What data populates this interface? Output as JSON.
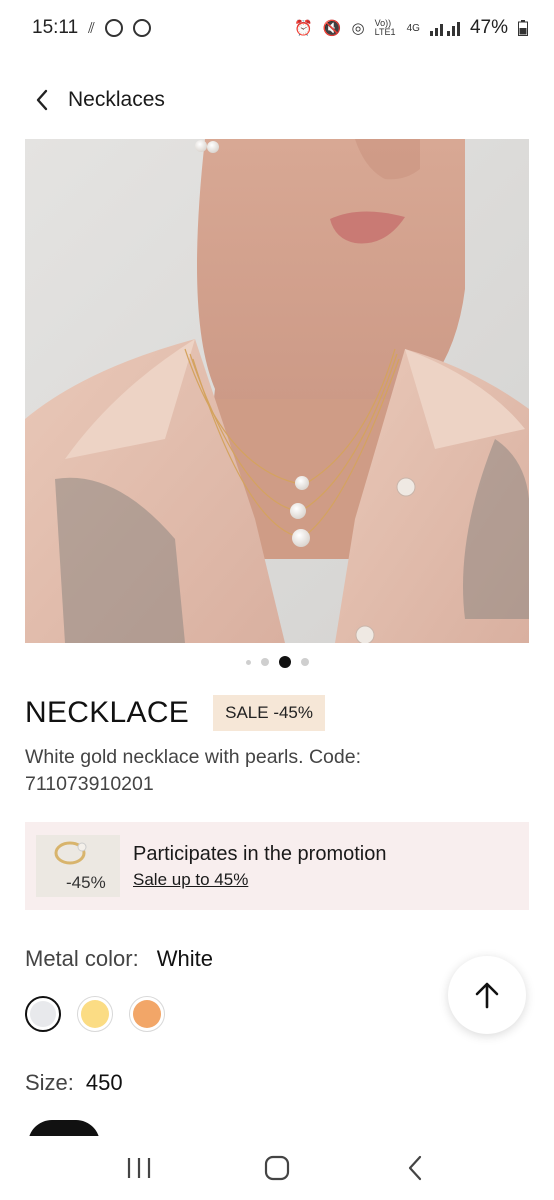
{
  "status_bar": {
    "time": "15:11",
    "battery": "47%",
    "network_volte": "Vo)) LTE1",
    "network_4g": "4G"
  },
  "header": {
    "title": "Necklaces",
    "back_icon": "chevron-left-icon"
  },
  "gallery": {
    "image_count": 4,
    "active_index": 2
  },
  "product": {
    "name": "NECKLACE",
    "sale_badge": "SALE -45%",
    "description": "White gold necklace with pearls. Code: 711073910201"
  },
  "promotion": {
    "thumb_text": "-45%",
    "title": "Participates in the promotion",
    "link": "Sale up to 45%"
  },
  "metal": {
    "label": "Metal color:",
    "value": "White",
    "swatches": [
      {
        "name": "white",
        "color": "#e8e9ec",
        "selected": true
      },
      {
        "name": "yellow",
        "color": "#fbdc84",
        "selected": false
      },
      {
        "name": "rose",
        "color": "#f2a668",
        "selected": false
      }
    ]
  },
  "size": {
    "label": "Size:",
    "value": "450"
  },
  "colors": {
    "sale_badge_bg": "#f6e7d7",
    "promo_bg": "#f8eeee",
    "text_dark": "#111111"
  }
}
